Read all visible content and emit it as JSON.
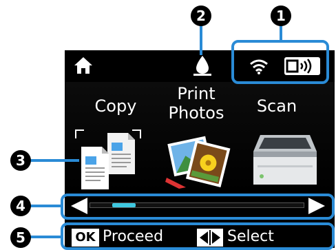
{
  "callouts": [
    "1",
    "2",
    "3",
    "4",
    "5"
  ],
  "menu": {
    "items": [
      {
        "label": "Copy",
        "icon": "copy-icon"
      },
      {
        "label": "Print\nPhotos",
        "icon": "photos-icon"
      },
      {
        "label": "Scan",
        "icon": "scanner-icon"
      }
    ]
  },
  "status": {
    "icons": [
      "home-icon",
      "ink-drop-icon",
      "wifi-icon",
      "wifi-direct-icon"
    ]
  },
  "scroll": {
    "position": 0.1
  },
  "buttons": {
    "ok_key": "OK",
    "ok_label": "Proceed",
    "select_label": "Select"
  },
  "colors": {
    "callout_line": "#2a8bd6",
    "scroll_thumb": "#3ec8e0"
  }
}
